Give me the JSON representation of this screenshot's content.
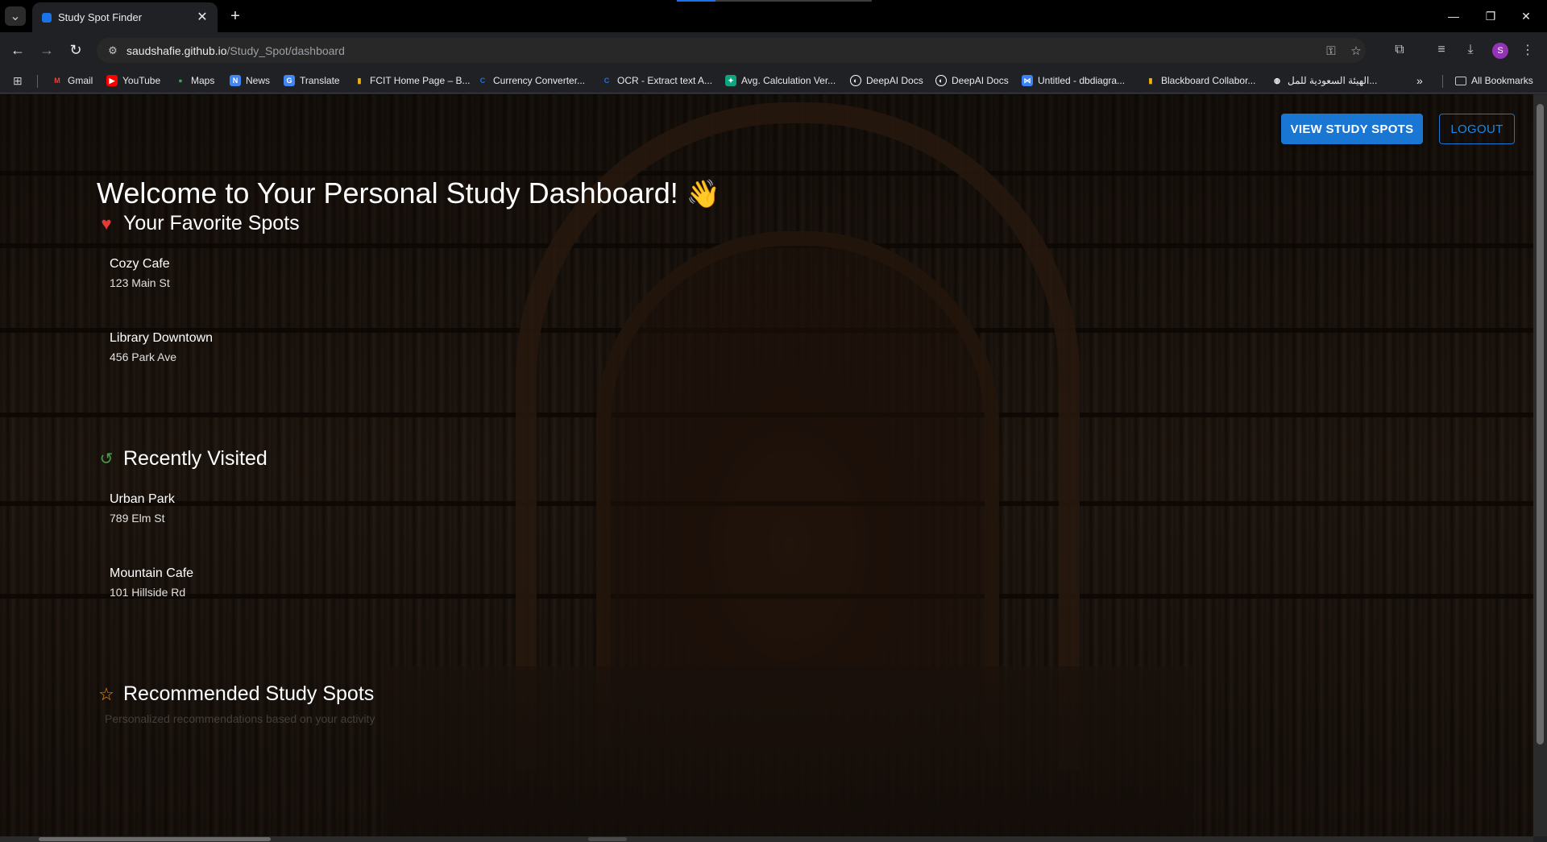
{
  "browser": {
    "tab_title": "Study Spot Finder",
    "url_host": "saudshafie.github.io",
    "url_path": "/Study_Spot/dashboard",
    "avatar_letter": "S",
    "bookmarks": [
      {
        "label": "Gmail",
        "icon": "gmail-icon",
        "color": "#ea4335"
      },
      {
        "label": "YouTube",
        "icon": "youtube-icon",
        "color": "#ff0000"
      },
      {
        "label": "Maps",
        "icon": "maps-icon",
        "color": "#34a853"
      },
      {
        "label": "News",
        "icon": "news-icon",
        "color": "#4285f4"
      },
      {
        "label": "Translate",
        "icon": "translate-icon",
        "color": "#4285f4"
      },
      {
        "label": "FCIT Home Page – B...",
        "icon": "bars-icon",
        "color": "#f4b400"
      },
      {
        "label": "Currency Converter...",
        "icon": "currency-icon",
        "color": "#1a73e8"
      },
      {
        "label": "OCR - Extract text A...",
        "icon": "ocr-icon",
        "color": "#1a73e8"
      },
      {
        "label": "Avg. Calculation Ver...",
        "icon": "calc-icon",
        "color": "#10a37f"
      },
      {
        "label": "DeepAI Docs",
        "icon": "deepai-icon",
        "color": "#ffffff"
      },
      {
        "label": "DeepAI Docs",
        "icon": "deepai-icon",
        "color": "#ffffff"
      },
      {
        "label": "Untitled - dbdiagra...",
        "icon": "dbdiagram-icon",
        "color": "#3b82f6"
      },
      {
        "label": "Blackboard Collabor...",
        "icon": "bars-icon",
        "color": "#f4b400"
      },
      {
        "label": "الهيئة السعودية للمل...",
        "icon": "globe-icon",
        "color": "#ffffff"
      }
    ],
    "all_bookmarks_label": "All Bookmarks"
  },
  "page": {
    "view_spots_label": "VIEW STUDY SPOTS",
    "logout_label": "LOGOUT",
    "welcome_text": "Welcome to Your Personal Study Dashboard!",
    "welcome_emoji": "👋",
    "favorites_title": "Your Favorite Spots",
    "favorites": [
      {
        "name": "Cozy Cafe",
        "address": "123 Main St"
      },
      {
        "name": "Library Downtown",
        "address": "456 Park Ave"
      }
    ],
    "recent_title": "Recently Visited",
    "recent": [
      {
        "name": "Urban Park",
        "address": "789 Elm St"
      },
      {
        "name": "Mountain Cafe",
        "address": "101 Hillside Rd"
      }
    ],
    "recommended_title": "Recommended Study Spots",
    "recommended_subtitle": "Personalized recommendations based on your activity",
    "colors": {
      "primary_button": "#1976d2",
      "heart": "#e53935",
      "history_icon": "#43a047",
      "star_icon": "#fb8c00"
    }
  }
}
